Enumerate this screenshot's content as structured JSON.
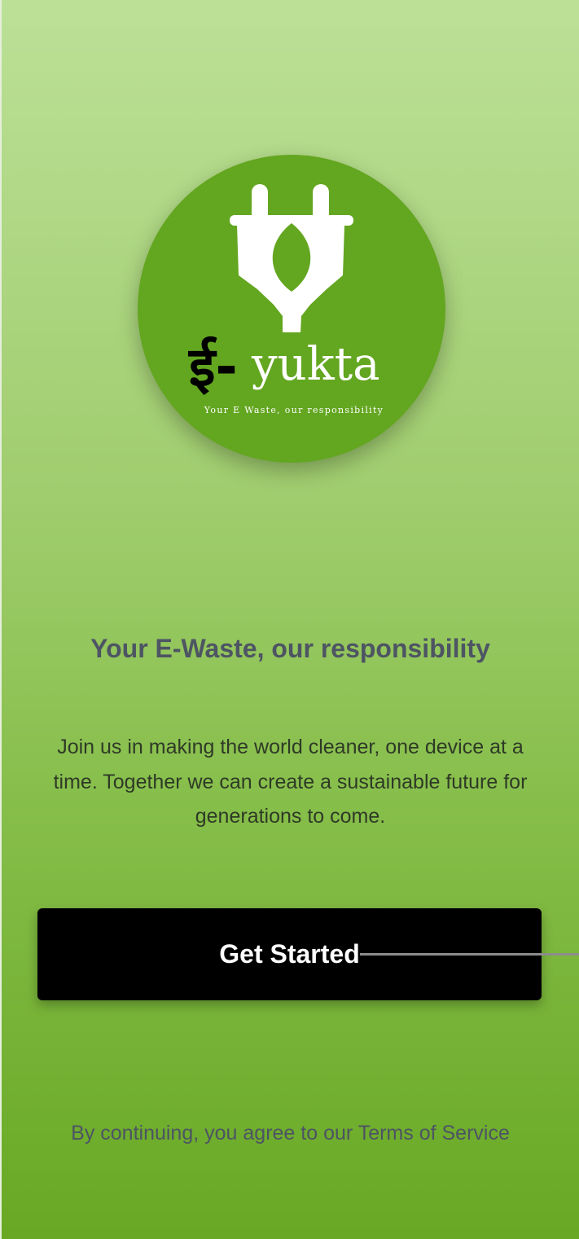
{
  "logo": {
    "devanagari_mark": "ई-",
    "brand_name": "yukta",
    "tagline": "Your E Waste, our responsibility"
  },
  "headline": "Your E-Waste, our responsibility",
  "description": "Join us in making the world cleaner, one device at a time. Together we can create a sustainable future for generations to come.",
  "cta": {
    "label": "Get Started"
  },
  "legal": "By continuing, you agree to our Terms of Service",
  "colors": {
    "background_top": "#bce097",
    "background_bottom": "#68a824",
    "logo_circle": "#63a620",
    "button": "#000000",
    "headline_text": "#4d5463"
  },
  "icons": {
    "logo_icon": "plug-with-leaf-icon"
  }
}
